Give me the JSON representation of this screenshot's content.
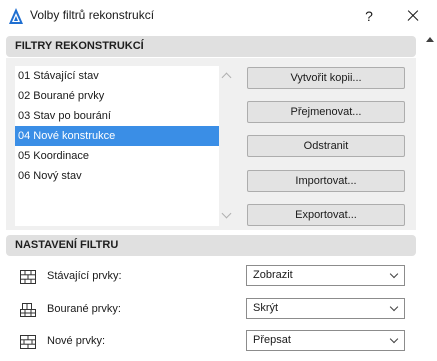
{
  "window": {
    "title": "Volby filtrů rekonstrukcí",
    "help_label": "?"
  },
  "filters_section": {
    "header": "FILTRY REKONSTRUKCÍ",
    "items": [
      {
        "label": "01 Stávající stav",
        "selected": false
      },
      {
        "label": "02 Bourané prvky",
        "selected": false
      },
      {
        "label": "03 Stav po bourání",
        "selected": false
      },
      {
        "label": "04 Nové konstrukce",
        "selected": true
      },
      {
        "label": "05 Koordinace",
        "selected": false
      },
      {
        "label": "06 Nový stav",
        "selected": false
      }
    ],
    "buttons": {
      "duplicate": "Vytvořit kopii...",
      "rename": "Přejmenovat...",
      "delete": "Odstranit",
      "import": "Importovat...",
      "export": "Exportovat..."
    }
  },
  "settings_section": {
    "header": "NASTAVENÍ FILTRU",
    "rows": [
      {
        "label": "Stávající prvky:",
        "value": "Zobrazit",
        "icon": "existing-elements-icon"
      },
      {
        "label": "Bourané prvky:",
        "value": "Skrýt",
        "icon": "demolished-elements-icon"
      },
      {
        "label": "Nové prvky:",
        "value": "Přepsat",
        "icon": "new-elements-icon"
      }
    ]
  },
  "colors": {
    "selection": "#3a8ee6",
    "panel": "#f0f0f0",
    "section_header": "#e0e0e0",
    "button": "#e3e3e3"
  }
}
